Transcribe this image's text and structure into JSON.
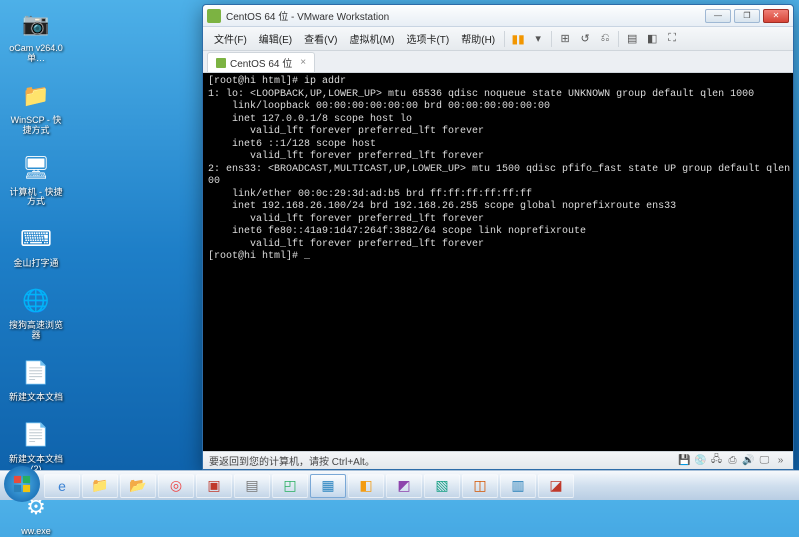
{
  "desktop_icons": [
    {
      "label": "oCam v264.0单…",
      "glyph": "📷"
    },
    {
      "label": "WinSCP - 快捷方式",
      "glyph": "📁"
    },
    {
      "label": "计算机 - 快捷方式",
      "glyph": "🖥"
    },
    {
      "label": "金山打字通",
      "glyph": "⌨"
    },
    {
      "label": "搜狗高速浏览器",
      "glyph": "🌐"
    },
    {
      "label": "新建文本文档",
      "glyph": "📄"
    },
    {
      "label": "新建文本文档 (2)",
      "glyph": "📄"
    },
    {
      "label": "ww.exe",
      "glyph": "⚙"
    }
  ],
  "window": {
    "title": "CentOS 64 位 - VMware Workstation",
    "min": "—",
    "max": "❐",
    "close": "✕"
  },
  "menu": {
    "items": [
      "文件(F)",
      "编辑(E)",
      "查看(V)",
      "虚拟机(M)",
      "选项卡(T)",
      "帮助(H)"
    ]
  },
  "tab": {
    "label": "CentOS 64 位",
    "close": "×"
  },
  "terminal": {
    "lines": [
      "[root@hi html]# ip addr",
      "1: lo: <LOOPBACK,UP,LOWER_UP> mtu 65536 qdisc noqueue state UNKNOWN group default qlen 1000",
      "    link/loopback 00:00:00:00:00:00 brd 00:00:00:00:00:00",
      "    inet 127.0.0.1/8 scope host lo",
      "       valid_lft forever preferred_lft forever",
      "    inet6 ::1/128 scope host",
      "       valid_lft forever preferred_lft forever",
      "2: ens33: <BROADCAST,MULTICAST,UP,LOWER_UP> mtu 1500 qdisc pfifo_fast state UP group default qlen 10",
      "00",
      "    link/ether 00:0c:29:3d:ad:b5 brd ff:ff:ff:ff:ff:ff",
      "    inet 192.168.26.100/24 brd 192.168.26.255 scope global noprefixroute ens33",
      "       valid_lft forever preferred_lft forever",
      "    inet6 fe80::41a9:1d47:264f:3882/64 scope link noprefixroute",
      "       valid_lft forever preferred_lft forever",
      "[root@hi html]# _"
    ]
  },
  "status": {
    "text": "要返回到您的计算机，请按 Ctrl+Alt。"
  },
  "taskbar": {
    "items": [
      {
        "name": "ie",
        "glyph": "e",
        "color": "#3b82d4"
      },
      {
        "name": "explorer",
        "glyph": "📁"
      },
      {
        "name": "folder",
        "glyph": "📂"
      },
      {
        "name": "chrome",
        "glyph": "◎",
        "color": "#e44"
      },
      {
        "name": "app1",
        "glyph": "▣",
        "color": "#c0392b"
      },
      {
        "name": "app2",
        "glyph": "▤",
        "color": "#777"
      },
      {
        "name": "app3",
        "glyph": "◰",
        "color": "#27ae60"
      },
      {
        "name": "vmware",
        "glyph": "▦",
        "color": "#2e86c1",
        "active": true
      },
      {
        "name": "app4",
        "glyph": "◧",
        "color": "#f39c12"
      },
      {
        "name": "app5",
        "glyph": "◩",
        "color": "#8e44ad"
      },
      {
        "name": "app6",
        "glyph": "▧",
        "color": "#16a085"
      },
      {
        "name": "app7",
        "glyph": "◫",
        "color": "#d35400"
      },
      {
        "name": "app8",
        "glyph": "▥",
        "color": "#2980b9"
      },
      {
        "name": "app9",
        "glyph": "◪",
        "color": "#c0392b"
      }
    ]
  }
}
